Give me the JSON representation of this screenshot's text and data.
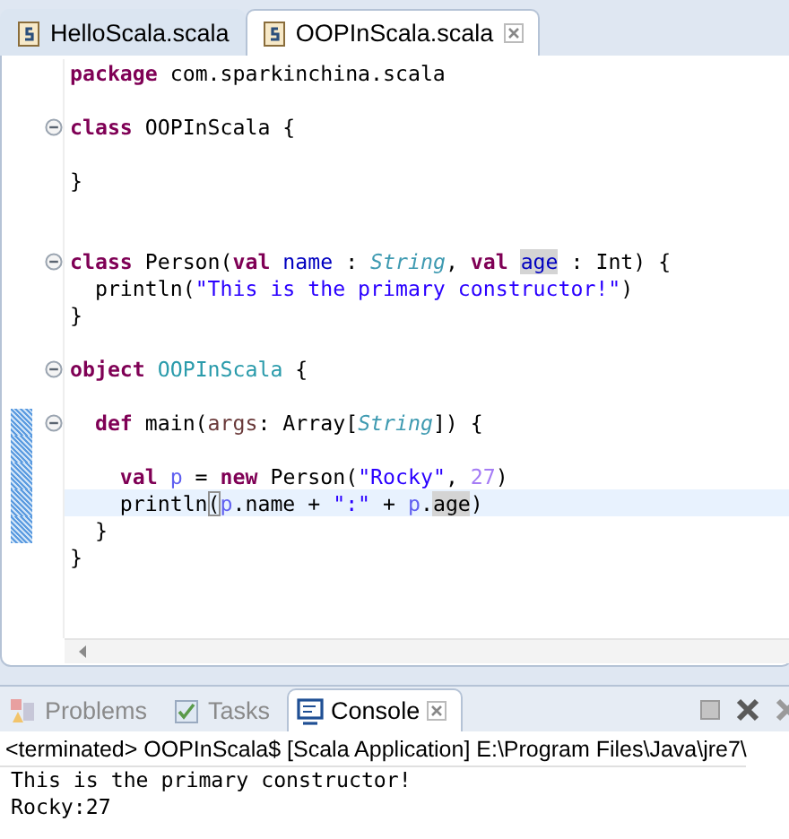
{
  "editor_tabs": [
    {
      "label": "HelloScala.scala",
      "selected": false,
      "closable": false
    },
    {
      "label": "OOPInScala.scala",
      "selected": true,
      "closable": true
    }
  ],
  "code_lines": [
    {
      "fold": false,
      "current": false,
      "range": false,
      "tokens": [
        {
          "text": "package",
          "kind": "keyword"
        },
        {
          "text": " com.sparkinchina.scala",
          "kind": "plain"
        }
      ]
    },
    {
      "fold": false,
      "current": false,
      "range": false
    },
    {
      "fold": true,
      "current": false,
      "range": false,
      "tokens": [
        {
          "text": "class",
          "kind": "keyword"
        },
        {
          "text": " OOPInScala {",
          "kind": "plain"
        }
      ]
    },
    {
      "fold": false,
      "current": false,
      "range": false
    },
    {
      "fold": false,
      "current": false,
      "range": false,
      "tokens": [
        {
          "text": "}",
          "kind": "plain"
        }
      ]
    },
    {
      "fold": false,
      "current": false,
      "range": false
    },
    {
      "fold": false,
      "current": false,
      "range": false
    },
    {
      "fold": true,
      "current": false,
      "range": false,
      "tokens": [
        {
          "text": "class",
          "kind": "keyword"
        },
        {
          "text": " Person(",
          "kind": "plain"
        },
        {
          "text": "val ",
          "kind": "keyword"
        },
        {
          "text": "name",
          "kind": "field"
        },
        {
          "text": " : ",
          "kind": "plain"
        },
        {
          "text": "String",
          "kind": "type"
        },
        {
          "text": ", ",
          "kind": "plain"
        },
        {
          "text": "val ",
          "kind": "keyword"
        },
        {
          "text": "age",
          "kind": "field",
          "marked": true
        },
        {
          "text": " : Int) {",
          "kind": "plain"
        }
      ]
    },
    {
      "fold": false,
      "current": false,
      "range": false,
      "tokens": [
        {
          "text": "  println(",
          "kind": "plain"
        },
        {
          "text": "\"This is the primary constructor!\"",
          "kind": "string"
        },
        {
          "text": ")",
          "kind": "plain"
        }
      ]
    },
    {
      "fold": false,
      "current": false,
      "range": false,
      "tokens": [
        {
          "text": "}",
          "kind": "plain"
        }
      ]
    },
    {
      "fold": false,
      "current": false,
      "range": false
    },
    {
      "fold": true,
      "current": false,
      "range": false,
      "tokens": [
        {
          "text": "object ",
          "kind": "keyword"
        },
        {
          "text": "OOPInScala",
          "kind": "object"
        },
        {
          "text": " {",
          "kind": "plain"
        }
      ]
    },
    {
      "fold": false,
      "current": false,
      "range": false
    },
    {
      "fold": true,
      "current": false,
      "range": true,
      "tokens": [
        {
          "text": "  def",
          "kind": "keyword"
        },
        {
          "text": " main(",
          "kind": "plain"
        },
        {
          "text": "args",
          "kind": "param"
        },
        {
          "text": ": Array[",
          "kind": "plain"
        },
        {
          "text": "String",
          "kind": "type"
        },
        {
          "text": "]) {",
          "kind": "plain"
        }
      ]
    },
    {
      "fold": false,
      "current": false,
      "range": true
    },
    {
      "fold": false,
      "current": false,
      "range": true,
      "tokens": [
        {
          "text": "    val ",
          "kind": "keyword"
        },
        {
          "text": "p",
          "kind": "local"
        },
        {
          "text": " = ",
          "kind": "plain"
        },
        {
          "text": "new",
          "kind": "keyword"
        },
        {
          "text": " Person(",
          "kind": "plain"
        },
        {
          "text": "\"Rocky\"",
          "kind": "string"
        },
        {
          "text": ", ",
          "kind": "plain"
        },
        {
          "text": "27",
          "kind": "number"
        },
        {
          "text": ")",
          "kind": "plain"
        }
      ]
    },
    {
      "fold": false,
      "current": true,
      "range": true,
      "tokens": [
        {
          "text": "    println",
          "kind": "plain"
        },
        {
          "text": "(",
          "kind": "plain",
          "matched": true
        },
        {
          "text": "p",
          "kind": "local"
        },
        {
          "text": ".name + ",
          "kind": "plain"
        },
        {
          "text": "\":\"",
          "kind": "string"
        },
        {
          "text": " + ",
          "kind": "plain"
        },
        {
          "text": "p",
          "kind": "local"
        },
        {
          "text": ".",
          "kind": "plain"
        },
        {
          "text": "age",
          "kind": "plain",
          "marked": true
        },
        {
          "text": ")",
          "kind": "plain"
        }
      ]
    },
    {
      "fold": false,
      "current": false,
      "range": true,
      "tokens": [
        {
          "text": "  }",
          "kind": "plain"
        }
      ]
    },
    {
      "fold": false,
      "current": false,
      "range": false,
      "tokens": [
        {
          "text": "}",
          "kind": "plain"
        }
      ]
    }
  ],
  "console": {
    "tabs": [
      {
        "label": "Problems",
        "selected": false,
        "closable": false
      },
      {
        "label": "Tasks",
        "selected": false,
        "closable": false
      },
      {
        "label": "Console",
        "selected": true,
        "closable": true
      }
    ],
    "header": "<terminated> OOPInScala$ [Scala Application] E:\\Program Files\\Java\\jre7\\",
    "output": [
      "This is the primary constructor!",
      "Rocky:27"
    ]
  }
}
